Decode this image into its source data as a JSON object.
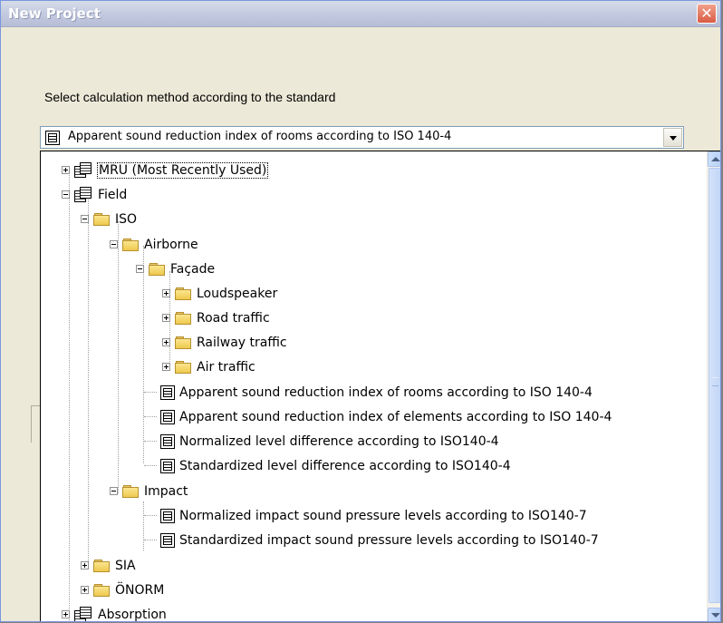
{
  "window": {
    "title": "New Project",
    "close_glyph": "✕"
  },
  "prompt": "Select calculation method according to the standard",
  "combo": {
    "value": "Apparent sound reduction index of rooms according to ISO 140-4",
    "icon": "calc-doc-icon"
  },
  "tree": {
    "items": [
      {
        "label": "MRU (Most Recently Used)",
        "kind": "group",
        "expander": "plus"
      },
      {
        "label": "Field",
        "kind": "group",
        "expander": "minus"
      },
      {
        "label": "ISO",
        "kind": "folder",
        "expander": "minus"
      },
      {
        "label": "Airborne",
        "kind": "folder",
        "expander": "minus"
      },
      {
        "label": "Façade",
        "kind": "folder",
        "expander": "minus"
      },
      {
        "label": "Loudspeaker",
        "kind": "folder",
        "expander": "plus"
      },
      {
        "label": "Road traffic",
        "kind": "folder",
        "expander": "plus"
      },
      {
        "label": "Railway traffic",
        "kind": "folder",
        "expander": "plus"
      },
      {
        "label": "Air traffic",
        "kind": "folder",
        "expander": "plus"
      },
      {
        "label": "Apparent sound reduction index of rooms according to ISO 140-4",
        "kind": "doc"
      },
      {
        "label": "Apparent sound reduction index of elements according to ISO 140-4",
        "kind": "doc"
      },
      {
        "label": "Normalized level difference according to ISO140-4",
        "kind": "doc"
      },
      {
        "label": "Standardized level difference according to ISO140-4",
        "kind": "doc"
      },
      {
        "label": "Impact",
        "kind": "folder",
        "expander": "minus"
      },
      {
        "label": "Normalized impact sound pressure levels according to ISO140-7",
        "kind": "doc"
      },
      {
        "label": "Standardized impact sound pressure levels according to ISO140-7",
        "kind": "doc"
      },
      {
        "label": "SIA",
        "kind": "folder",
        "expander": "plus"
      },
      {
        "label": "ÖNORM",
        "kind": "folder",
        "expander": "plus"
      },
      {
        "label": "Absorption",
        "kind": "group",
        "expander": "plus"
      }
    ]
  }
}
